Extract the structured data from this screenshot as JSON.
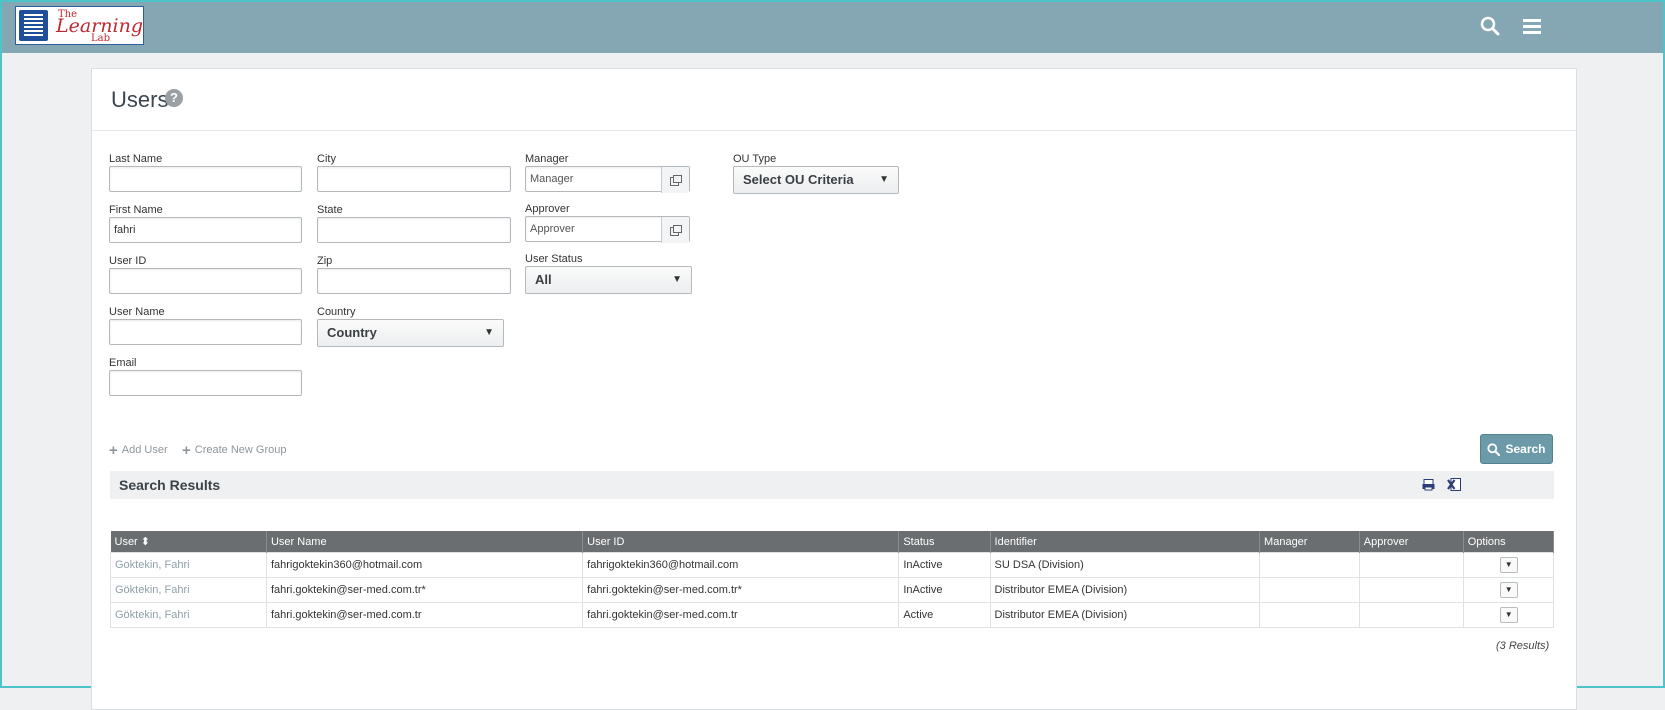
{
  "header": {
    "logo": {
      "line1": "The",
      "line2": "Learning",
      "line3": "Lab"
    }
  },
  "page": {
    "title": "Users",
    "help_label": "?"
  },
  "form": {
    "last_name": {
      "label": "Last Name",
      "value": ""
    },
    "first_name": {
      "label": "First Name",
      "value": "fahri"
    },
    "user_id": {
      "label": "User ID",
      "value": ""
    },
    "user_name": {
      "label": "User Name",
      "value": ""
    },
    "email": {
      "label": "Email",
      "value": ""
    },
    "city": {
      "label": "City",
      "value": ""
    },
    "state": {
      "label": "State",
      "value": ""
    },
    "zip": {
      "label": "Zip",
      "value": ""
    },
    "country": {
      "label": "Country",
      "selected": "Country"
    },
    "manager": {
      "label": "Manager",
      "placeholder": "Manager"
    },
    "approver": {
      "label": "Approver",
      "placeholder": "Approver"
    },
    "user_status": {
      "label": "User Status",
      "selected": "All"
    },
    "ou_type": {
      "label": "OU Type",
      "selected": "Select OU Criteria"
    }
  },
  "actions": {
    "search": "Search",
    "add_user": "Add User",
    "create_group": "Create New Group"
  },
  "results": {
    "title": "Search Results",
    "columns": [
      "User",
      "User Name",
      "User ID",
      "Status",
      "Identifier",
      "Manager",
      "Approver",
      "Options"
    ],
    "sort_glyph": "⬍",
    "rows": [
      {
        "user": "Goktekin, Fahri",
        "user_name": "fahrigoktekin360@hotmail.com",
        "user_id": "fahrigoktekin360@hotmail.com",
        "status": "InActive",
        "identifier": "SU DSA (Division)",
        "manager": "",
        "approver": ""
      },
      {
        "user": "Göktekin, Fahri",
        "user_name": "fahri.goktekin@ser-med.com.tr*",
        "user_id": "fahri.goktekin@ser-med.com.tr*",
        "status": "InActive",
        "identifier": "Distributor EMEA (Division)",
        "manager": "",
        "approver": ""
      },
      {
        "user": "Göktekin, Fahri",
        "user_name": "fahri.goktekin@ser-med.com.tr",
        "user_id": "fahri.goktekin@ser-med.com.tr",
        "status": "Active",
        "identifier": "Distributor EMEA (Division)",
        "manager": "",
        "approver": ""
      }
    ],
    "count": "(3 Results)"
  },
  "icons": {
    "search": "search-icon",
    "menu": "hamburger-menu-icon",
    "print": "print-icon",
    "excel": "excel-export-icon",
    "lookup": "lookup-icon",
    "sort": "sort-icon"
  },
  "colors": {
    "topbar": "#85a7b3",
    "accent": "#6d9aa8",
    "table_header": "#6b6e70"
  }
}
